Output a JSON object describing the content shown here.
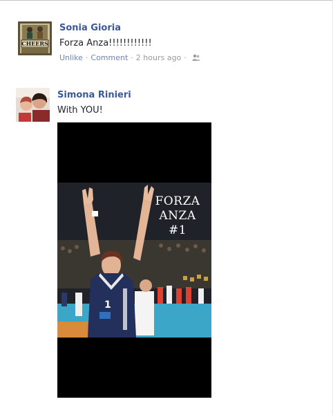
{
  "posts": [
    {
      "author": "Sonia Gioria",
      "message": "Forza Anza!!!!!!!!!!!!",
      "actions": {
        "unlike": "Unlike",
        "comment": "Comment",
        "time": "2 hours ago",
        "separator": "·"
      },
      "avatar_sign": "CHEERS"
    },
    {
      "author": "Simona Rinieri",
      "message": "With YOU!",
      "photo": {
        "caption_line1": "FORZA",
        "caption_line2": "ANZA #1",
        "jersey_number": "1"
      }
    }
  ],
  "colors": {
    "author_link": "#3b5998",
    "action_link": "#6d84b4",
    "court_blue": "#3ba6c8",
    "court_orange": "#d98a3a"
  }
}
